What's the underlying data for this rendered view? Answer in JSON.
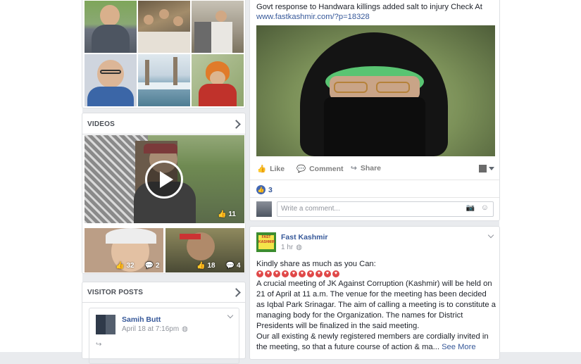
{
  "photos_grid": {
    "items": [
      "photo-1",
      "photo-2",
      "photo-3",
      "photo-4",
      "photo-5",
      "photo-6"
    ]
  },
  "videos": {
    "heading": "VIDEOS",
    "main_likes": "11",
    "thumb1": {
      "likes": "32",
      "comments": "2"
    },
    "thumb2": {
      "likes": "18",
      "comments": "4"
    }
  },
  "visitor_posts": {
    "heading": "VISITOR POSTS",
    "post": {
      "author": "Samih Butt",
      "time": "April 18 at 7:16pm"
    }
  },
  "post1": {
    "text_line1": "Govt response to Handwara killings added salt to injury Check At",
    "link": "www.fastkashmir.com/?p=18328",
    "actions": {
      "like": "Like",
      "comment": "Comment",
      "share": "Share"
    },
    "reactions_count": "3",
    "comment_placeholder": "Write a comment..."
  },
  "post2": {
    "page_name": "Fast Kashmir",
    "logo_text": "FAST KASHMIR",
    "time": "1 hr",
    "intro": "Kindly share as much as you Can:",
    "heart_count": 10,
    "body": "A crucial meeting of JK Against Corruption (Kashmir) will be held on 21 of April at 11 a.m. The venue for the meeting has been decided as Iqbal Park Srinagar. The aim of calling a meeting is to constitute a managing body for the Organization. The names for District Presidents will be finalized in the said meeting.",
    "body2": "Our all existing & newly registered members are cordially invited in the meeting, so that a future course of action & ma...",
    "see_more": "See More"
  },
  "colors": {
    "accent": "#365899",
    "bg": "#e9ebee",
    "like_blue": "#4267b2"
  }
}
